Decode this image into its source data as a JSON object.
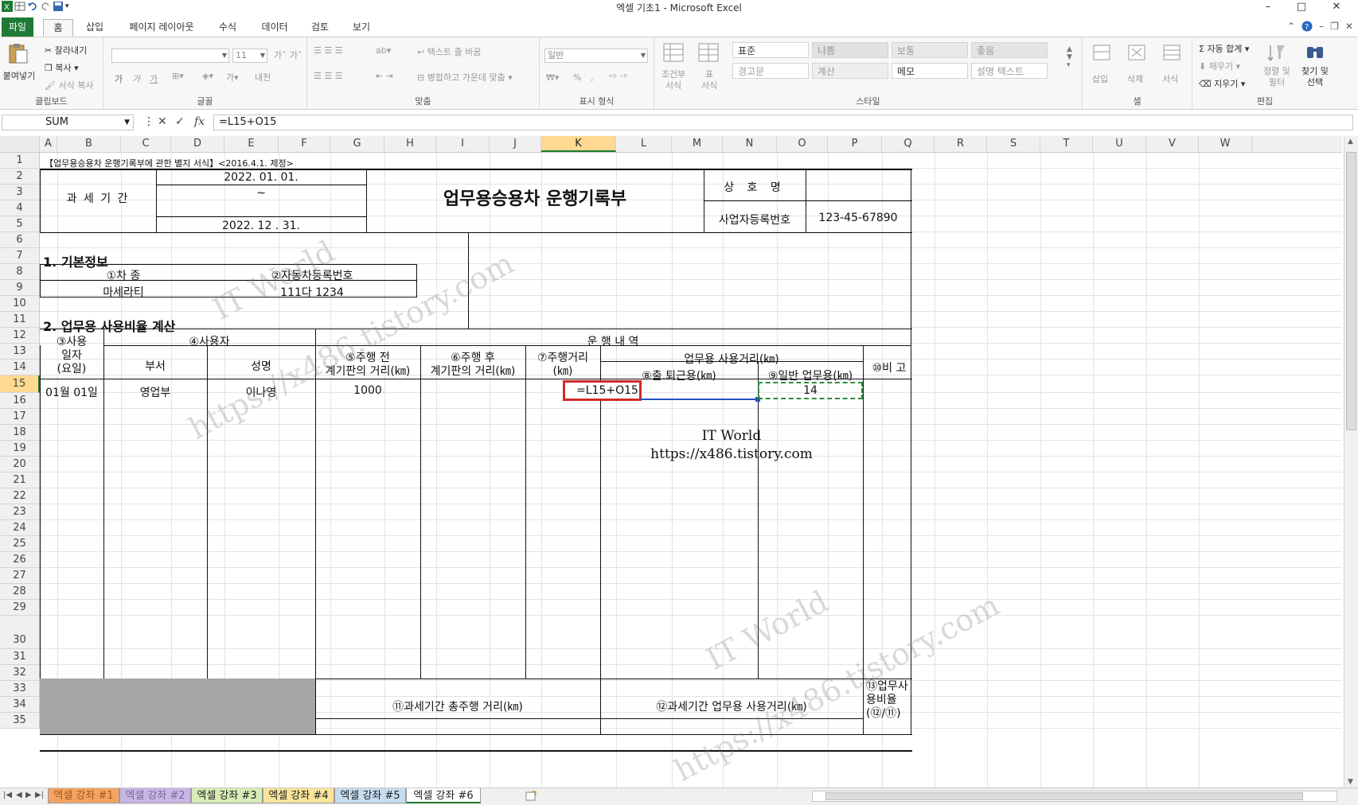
{
  "window": {
    "title": "엑셀 기초1 - Microsoft Excel",
    "controls": [
      "–",
      "□",
      "✕"
    ]
  },
  "ribbon_tabs": [
    "파일",
    "홈",
    "삽입",
    "페이지 레이아웃",
    "수식",
    "데이터",
    "검토",
    "보기"
  ],
  "ribbon": {
    "clipboard": {
      "paste": "붙여넣기",
      "cut": "잘라내기",
      "copy": "복사",
      "format_painter": "서식 복사",
      "label": "클립보드"
    },
    "font": {
      "size": "11",
      "bold": "가",
      "italic": "가",
      "underline": "가",
      "label": "글꼴",
      "ext": "내천"
    },
    "align": {
      "wrap": "텍스트 줄 바꿈",
      "merge": "병합하고 가운데 맞춤",
      "label": "맞춤"
    },
    "number": {
      "format": "일반",
      "label": "표시 형식",
      "pct": "%",
      "comma": ","
    },
    "styles": {
      "cond": "조건부\n서식",
      "table": "표\n서식",
      "cells": [
        {
          "text": "표준",
          "bg": "#ffffff",
          "color": "#333333"
        },
        {
          "text": "나쁨",
          "bg": "#e1e1e1",
          "color": "#9a9a9a"
        },
        {
          "text": "보통",
          "bg": "#e9e9e9",
          "color": "#9a9a9a"
        },
        {
          "text": "좋음",
          "bg": "#e4e4e4",
          "color": "#9a9a9a"
        },
        {
          "text": "경고문",
          "bg": "#ffffff",
          "color": "#9a9a9a"
        },
        {
          "text": "계산",
          "bg": "#eeeeee",
          "color": "#9a9a9a"
        },
        {
          "text": "메모",
          "bg": "#ffffff",
          "color": "#333333"
        },
        {
          "text": "설명 텍스트",
          "bg": "#ffffff",
          "color": "#9a9a9a"
        }
      ],
      "label": "스타일"
    },
    "cells_group": {
      "insert": "삽입",
      "delete": "삭제",
      "format": "서식",
      "label": "셀"
    },
    "editing": {
      "autosum": "Σ 자동 합계",
      "fill": "채우기",
      "clear": "지우기",
      "sort": "정렬 및\n필터",
      "find": "찾기 및\n선택",
      "label": "편집"
    }
  },
  "formula_bar": {
    "name_box": "SUM",
    "formula": "=L15+O15"
  },
  "columns": [
    "A",
    "B",
    "C",
    "D",
    "E",
    "F",
    "G",
    "H",
    "I",
    "J",
    "K",
    "L",
    "M",
    "N",
    "O",
    "P",
    "Q",
    "R",
    "S",
    "T",
    "U",
    "V",
    "W"
  ],
  "selected_column": "K",
  "rows": [
    "1",
    "2",
    "3",
    "4",
    "5",
    "6",
    "7",
    "8",
    "9",
    "10",
    "11",
    "12",
    "13",
    "14",
    "15",
    "16",
    "17",
    "18",
    "19",
    "20",
    "21",
    "22",
    "23",
    "24",
    "25",
    "26",
    "27",
    "28",
    "29",
    "30",
    "31",
    "32",
    "33",
    "34",
    "35"
  ],
  "selected_row": "15",
  "sheet": {
    "header_note": "【업무용승용차 운행기록부에 관한 별지 서식】<2016.4.1. 제정>",
    "period_label": "과 세 기 간",
    "period_start": "2022.  01.  01.",
    "period_tilde": "~",
    "period_end": "2022.   12 .   31.",
    "doc_title": "업무용승용차 운행기록부",
    "company_label": "상  호  명",
    "company_value": "",
    "bizno_label": "사업자등록번호",
    "bizno_value": "123-45-67890",
    "section1": "1. 기본정보",
    "car_type_label": "①차 종",
    "car_reg_label": "②자동차등록번호",
    "car_type": "마세라티",
    "car_reg": "111다 1234",
    "section2": "2. 업무용 사용비율 계산",
    "h_date": "③사용\n일자\n(요일)",
    "h_user": "④사용자",
    "h_dept": "부서",
    "h_name": "성명",
    "h_ops": "운 행    내 역",
    "h_before": "⑤주행 전\n계기판의 거리(㎞)",
    "h_after": "⑥주행 후\n계기판의 거리(㎞)",
    "h_dist": "⑦주행거리\n(㎞)",
    "h_biz": "업무용 사용거리(㎞)",
    "h_commute": "⑧출.퇴근용(㎞)",
    "h_general": "⑨일반 업무용(㎞)",
    "h_note": "⑩비 고",
    "r15_date": "01월 01일",
    "r15_dept": "영업부",
    "r15_name": "이나영",
    "r15_before": "1000",
    "r15_formula": "=L15+O15",
    "r15_general": "14",
    "total_dist": "⑪과세기간 총주행 거리(㎞)",
    "total_biz": "⑫과세기간 업무용 사용거리(㎞)",
    "ratio": "⑬업무사\n용비율\n(⑫/⑪)",
    "watermark_name": "IT World",
    "watermark_url": "https://x486.tistory.com"
  },
  "sheet_tabs": [
    {
      "name": "엑셀 강좌 #1",
      "bg": "#f4a460",
      "color": "#a05a20"
    },
    {
      "name": "엑셀 강좌 #2",
      "bg": "#c8b6e6",
      "color": "#7a6a9a"
    },
    {
      "name": "엑셀 강좌 #3",
      "bg": "#d9ecb6",
      "color": "#222222"
    },
    {
      "name": "엑셀 강좌 #4",
      "bg": "#f9e49a",
      "color": "#222222"
    },
    {
      "name": "엑셀 강좌 #5",
      "bg": "#c6ddf0",
      "color": "#222222"
    },
    {
      "name": "엑셀 강좌 #6",
      "bg": "#ffffff",
      "color": "#222222"
    }
  ]
}
